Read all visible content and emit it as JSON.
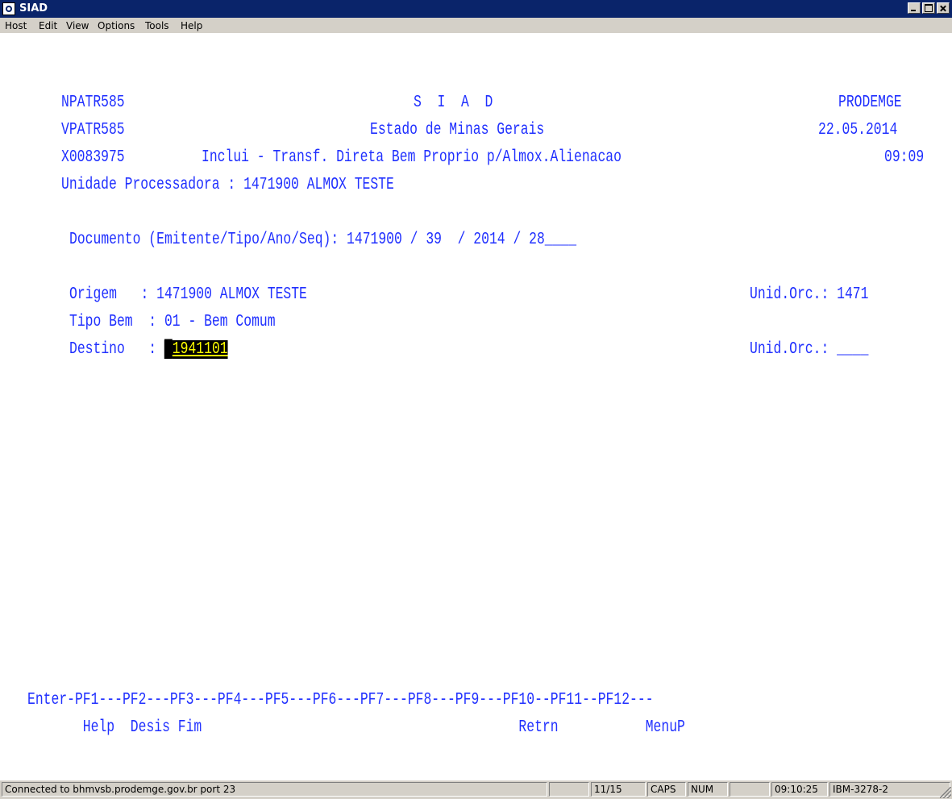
{
  "window": {
    "title": "SIAD"
  },
  "menu": [
    {
      "label": "Host"
    },
    {
      "label": "Edit"
    },
    {
      "label": "View"
    },
    {
      "label": "Options"
    },
    {
      "label": "Tools"
    },
    {
      "label": "Help"
    }
  ],
  "screen": {
    "header": {
      "program": "NPATR585",
      "system": "S  I  A  D",
      "company": "PRODEMGE",
      "view": "VPATR585",
      "state": "Estado de Minas Gerais",
      "date": "22.05.2014",
      "user": "X0083975",
      "function": "Inclui - Transf. Direta Bem Proprio p/Almox.Alienacao",
      "time": "09:09"
    },
    "unit_line": "Unidade Processadora : 1471900 ALMOX TESTE",
    "document_line": "Documento (Emitente/Tipo/Ano/Seq): 1471900 / 39  / 2014 / 28____",
    "origem_line": "Origem   : 1471900 ALMOX TESTE",
    "origem_unid": "Unid.Orc.: 1471",
    "tipo_line": "Tipo Bem  : 01 - Bem Comum",
    "destino_label": "Destino   : ",
    "destino_value": "1941101",
    "destino_unid_label": "Unid.Orc.: ",
    "destino_unid_value": "____",
    "pf_keys_line": "Enter-PF1---PF2---PF3---PF4---PF5---PF6---PF7---PF8---PF9---PF10--PF11--PF12---",
    "pf_labels_line": "       Help  Desis Fim                                        Retrn           MenuP"
  },
  "status": {
    "connection": "Connected to bhmvsb.prodemge.gov.br port 23",
    "cursor_pos": "11/15",
    "caps": "CAPS",
    "num": "NUM",
    "clock": "09:10:25",
    "terminal": "IBM-3278-2"
  }
}
